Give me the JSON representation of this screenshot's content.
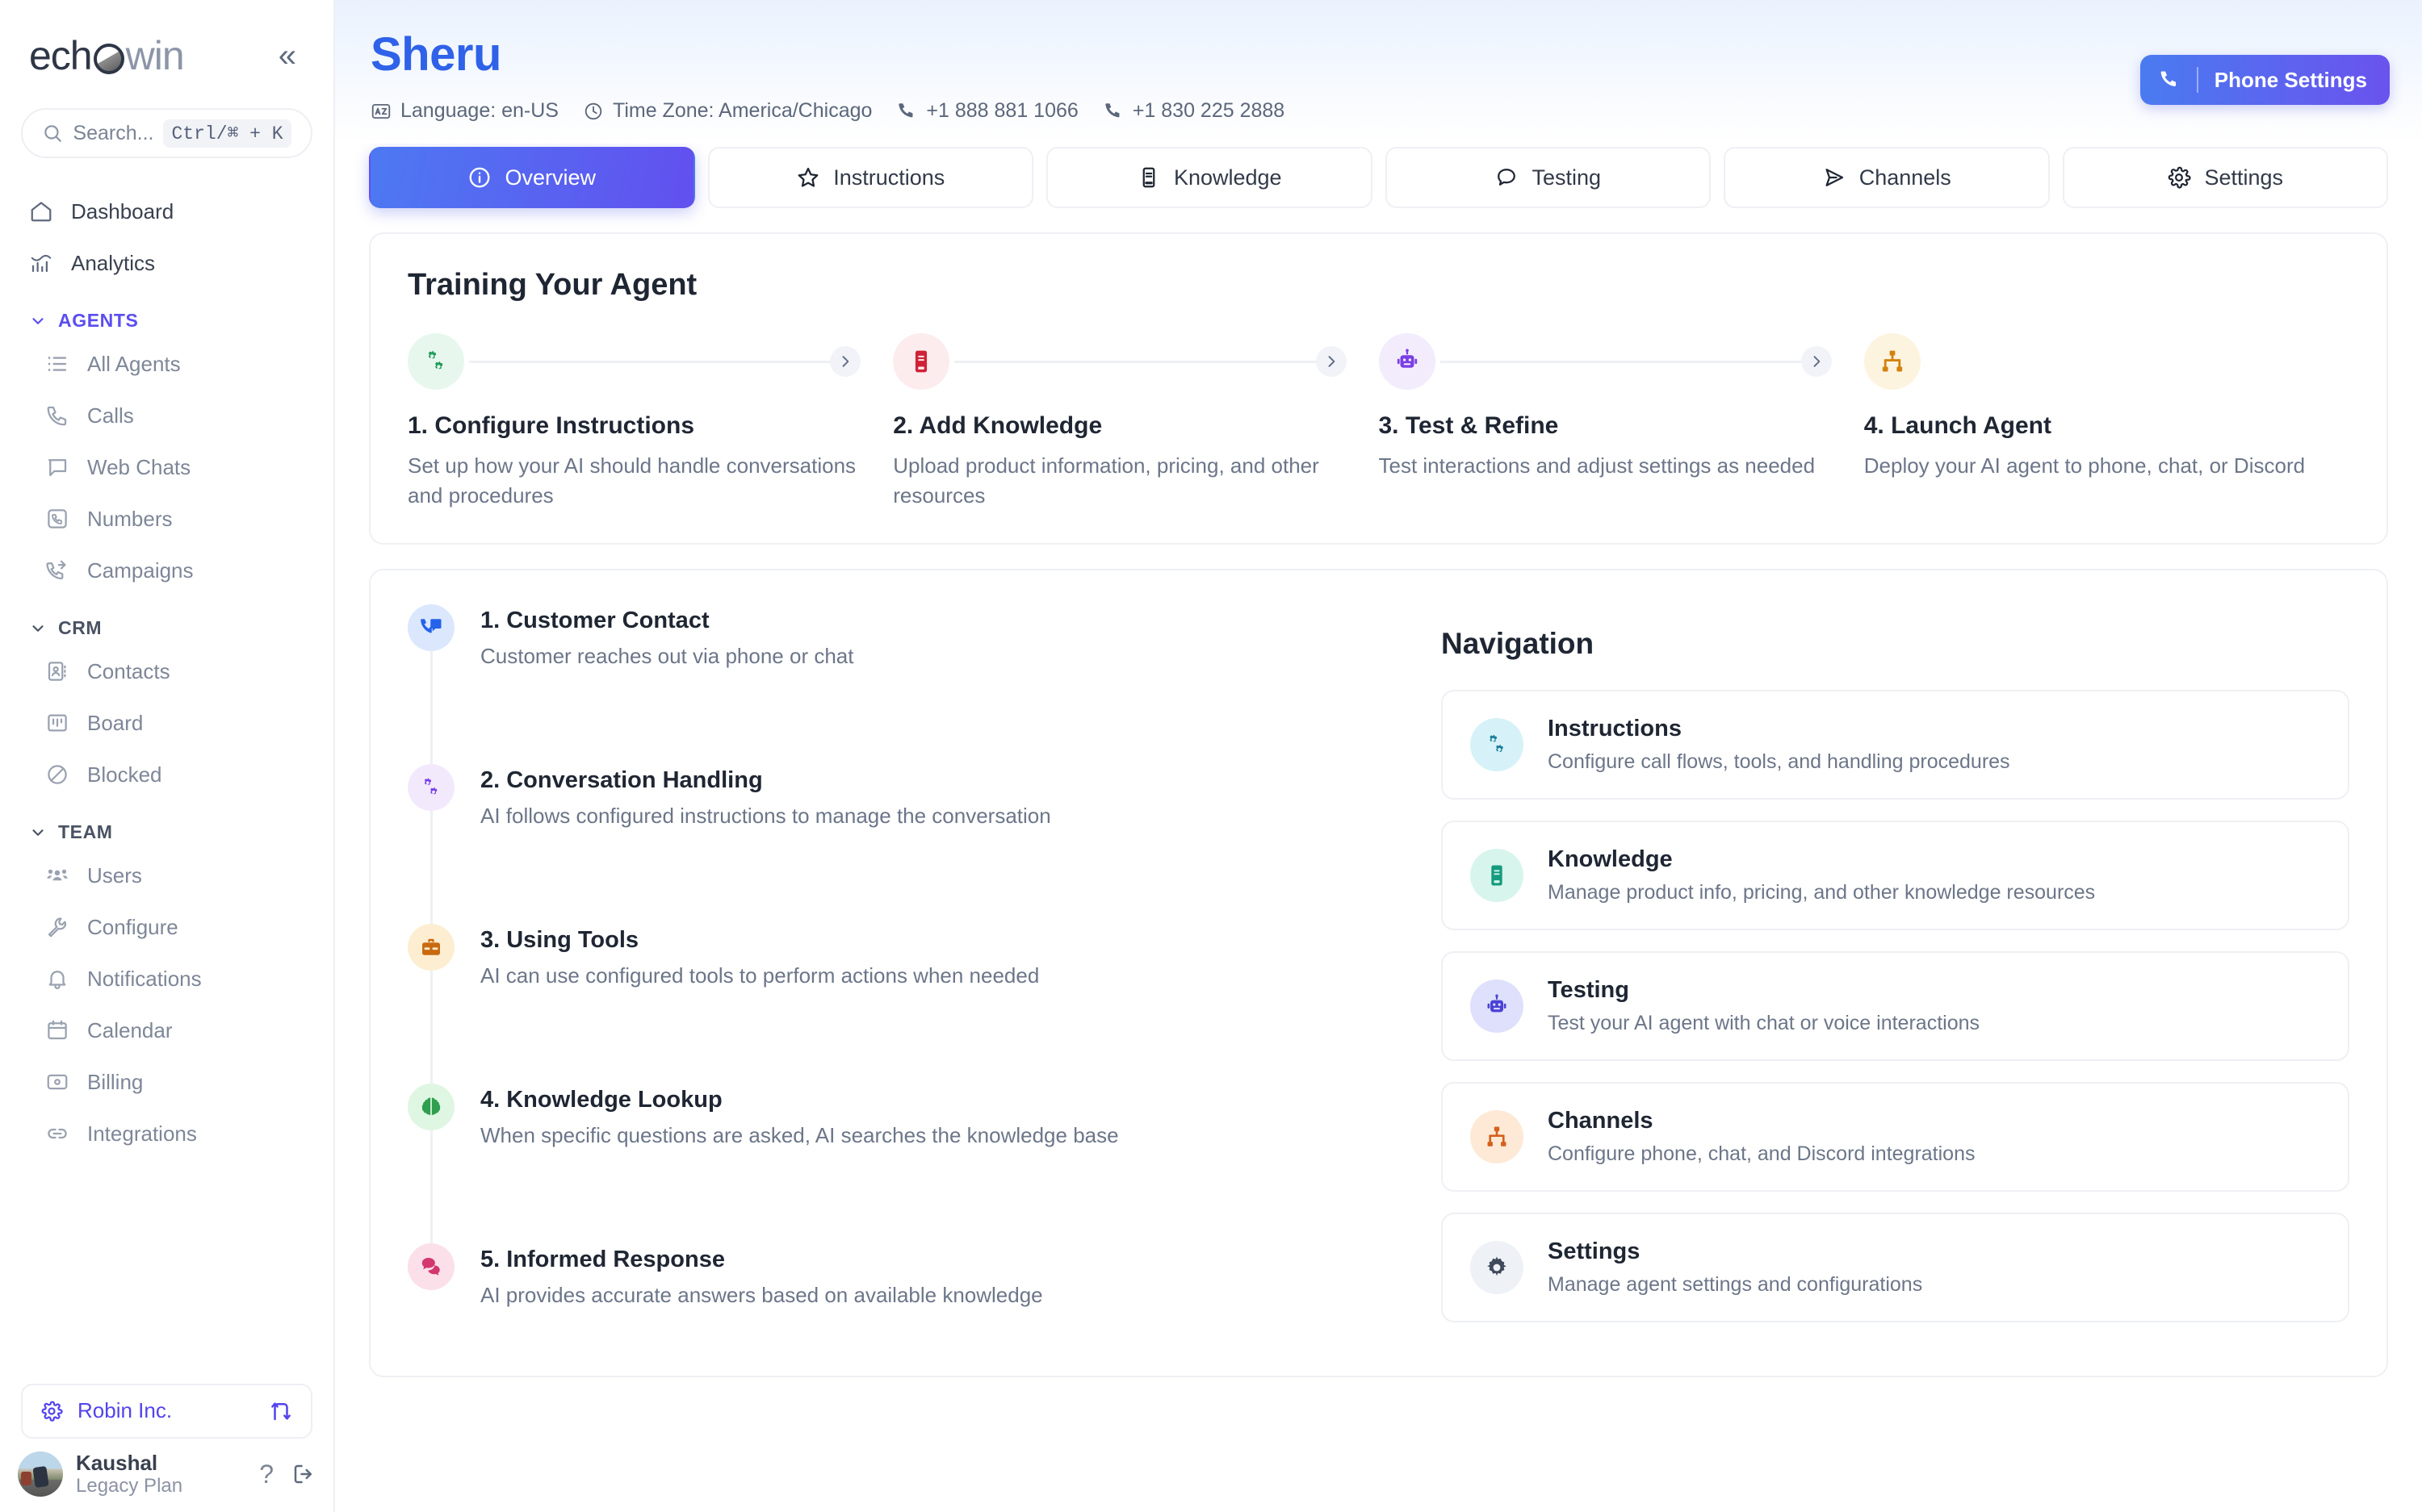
{
  "sidebar": {
    "logo": {
      "part1": "ech",
      "part2": "win",
      "mark": "o-circle-logo-mark"
    },
    "collapse_label": "«",
    "search": {
      "placeholder": "Search...",
      "shortcut": "Ctrl/⌘ + K"
    },
    "top_items": [
      {
        "label": "Dashboard",
        "icon": "home-icon"
      },
      {
        "label": "Analytics",
        "icon": "chart-icon"
      }
    ],
    "groups": [
      {
        "label": "AGENTS",
        "accent": "#5b4ef0",
        "items": [
          {
            "label": "All Agents",
            "icon": "list-icon"
          },
          {
            "label": "Calls",
            "icon": "phone-icon"
          },
          {
            "label": "Web Chats",
            "icon": "chat-bubble-icon"
          },
          {
            "label": "Numbers",
            "icon": "phone-square-icon"
          },
          {
            "label": "Campaigns",
            "icon": "phone-forward-icon"
          }
        ]
      },
      {
        "label": "CRM",
        "accent": "#4a5364",
        "items": [
          {
            "label": "Contacts",
            "icon": "contact-book-icon"
          },
          {
            "label": "Board",
            "icon": "board-icon"
          },
          {
            "label": "Blocked",
            "icon": "block-icon"
          }
        ]
      },
      {
        "label": "TEAM",
        "accent": "#4a5364",
        "items": [
          {
            "label": "Users",
            "icon": "users-icon"
          },
          {
            "label": "Configure",
            "icon": "wrench-icon"
          },
          {
            "label": "Notifications",
            "icon": "bell-icon"
          },
          {
            "label": "Calendar",
            "icon": "calendar-icon"
          },
          {
            "label": "Billing",
            "icon": "billing-card-icon"
          },
          {
            "label": "Integrations",
            "icon": "link-icon"
          }
        ]
      }
    ],
    "org": {
      "name": "Robin Inc.",
      "gear_icon": "gear-icon",
      "switch_icon": "switch-org-icon"
    },
    "user": {
      "name": "Kaushal",
      "plan": "Legacy Plan",
      "help_icon": "help-icon",
      "logout_icon": "logout-icon"
    }
  },
  "header": {
    "agent_name": "Sheru",
    "meta": [
      {
        "icon": "languages-icon",
        "text": "Language: en-US"
      },
      {
        "icon": "clock-icon",
        "text": "Time Zone: America/Chicago"
      },
      {
        "icon": "phone-icon",
        "text": "+1 888 881 1066"
      },
      {
        "icon": "phone-icon",
        "text": "+1 830 225 2888"
      }
    ],
    "phone_settings_label": "Phone Settings",
    "phone_settings_icon": "phone-icon",
    "accent_title_color": "#2f62e8",
    "accent_button_gradient": "#4a7bf0 → #6a53ee"
  },
  "tabs": [
    {
      "label": "Overview",
      "icon": "info-icon",
      "active": true
    },
    {
      "label": "Instructions",
      "icon": "star-icon",
      "active": false
    },
    {
      "label": "Knowledge",
      "icon": "book-icon",
      "active": false
    },
    {
      "label": "Testing",
      "icon": "chat-bubble-icon",
      "active": false
    },
    {
      "label": "Channels",
      "icon": "send-icon",
      "active": false
    },
    {
      "label": "Settings",
      "icon": "gear-icon",
      "active": false
    }
  ],
  "training": {
    "title": "Training Your Agent",
    "steps": [
      {
        "name": "1. Configure Instructions",
        "desc": "Set up how your AI should handle conversations and procedures",
        "icon": "gears-icon",
        "color": "#1f9d5a",
        "bg": "#e8f7ee"
      },
      {
        "name": "2. Add Knowledge",
        "desc": "Upload product information, pricing, and other resources",
        "icon": "book-icon",
        "color": "#cf2237",
        "bg": "#fdecee"
      },
      {
        "name": "3. Test & Refine",
        "desc": "Test interactions and adjust settings as needed",
        "icon": "robot-icon",
        "color": "#7b3fe4",
        "bg": "#f2ecfd"
      },
      {
        "name": "4. Launch Agent",
        "desc": "Deploy your AI agent to phone, chat, or Discord",
        "icon": "network-icon",
        "color": "#d4820f",
        "bg": "#fdf4e0"
      }
    ]
  },
  "flow": {
    "items": [
      {
        "name": "1. Customer Contact",
        "desc": "Customer reaches out via phone or chat",
        "icon": "phone-chat-icon",
        "color": "#2563eb",
        "bg": "#dbe7fd"
      },
      {
        "name": "2. Conversation Handling",
        "desc": "AI follows configured instructions to manage the conversation",
        "icon": "gears-icon",
        "color": "#7b3fe4",
        "bg": "#f2e9fd"
      },
      {
        "name": "3. Using Tools",
        "desc": "AI can use configured tools to perform actions when needed",
        "icon": "toolbox-icon",
        "color": "#c96a10",
        "bg": "#fdeed2"
      },
      {
        "name": "4. Knowledge Lookup",
        "desc": "When specific questions are asked, AI searches the knowledge base",
        "icon": "brain-icon",
        "color": "#2e9e4f",
        "bg": "#dff6e3"
      },
      {
        "name": "5. Informed Response",
        "desc": "AI provides accurate answers based on available knowledge",
        "icon": "chat-bubbles-icon",
        "color": "#d2376e",
        "bg": "#fbe0ea"
      }
    ]
  },
  "navigation": {
    "title": "Navigation",
    "cards": [
      {
        "title": "Instructions",
        "desc": "Configure call flows, tools, and handling procedures",
        "icon": "gears-icon",
        "color": "#1a7f9c",
        "bg": "#d6f2f8"
      },
      {
        "title": "Knowledge",
        "desc": "Manage product info, pricing, and other knowledge resources",
        "icon": "book-icon",
        "color": "#159b7e",
        "bg": "#d7f5ec"
      },
      {
        "title": "Testing",
        "desc": "Test your AI agent with chat or voice interactions",
        "icon": "robot-icon",
        "color": "#4a42d6",
        "bg": "#dfe0fb"
      },
      {
        "title": "Channels",
        "desc": "Configure phone, chat, and Discord integrations",
        "icon": "network-icon",
        "color": "#d4611c",
        "bg": "#fde9d6"
      },
      {
        "title": "Settings",
        "desc": "Manage agent settings and configurations",
        "icon": "gear-icon",
        "color": "#3f4a5c",
        "bg": "#eef1f5"
      }
    ]
  }
}
